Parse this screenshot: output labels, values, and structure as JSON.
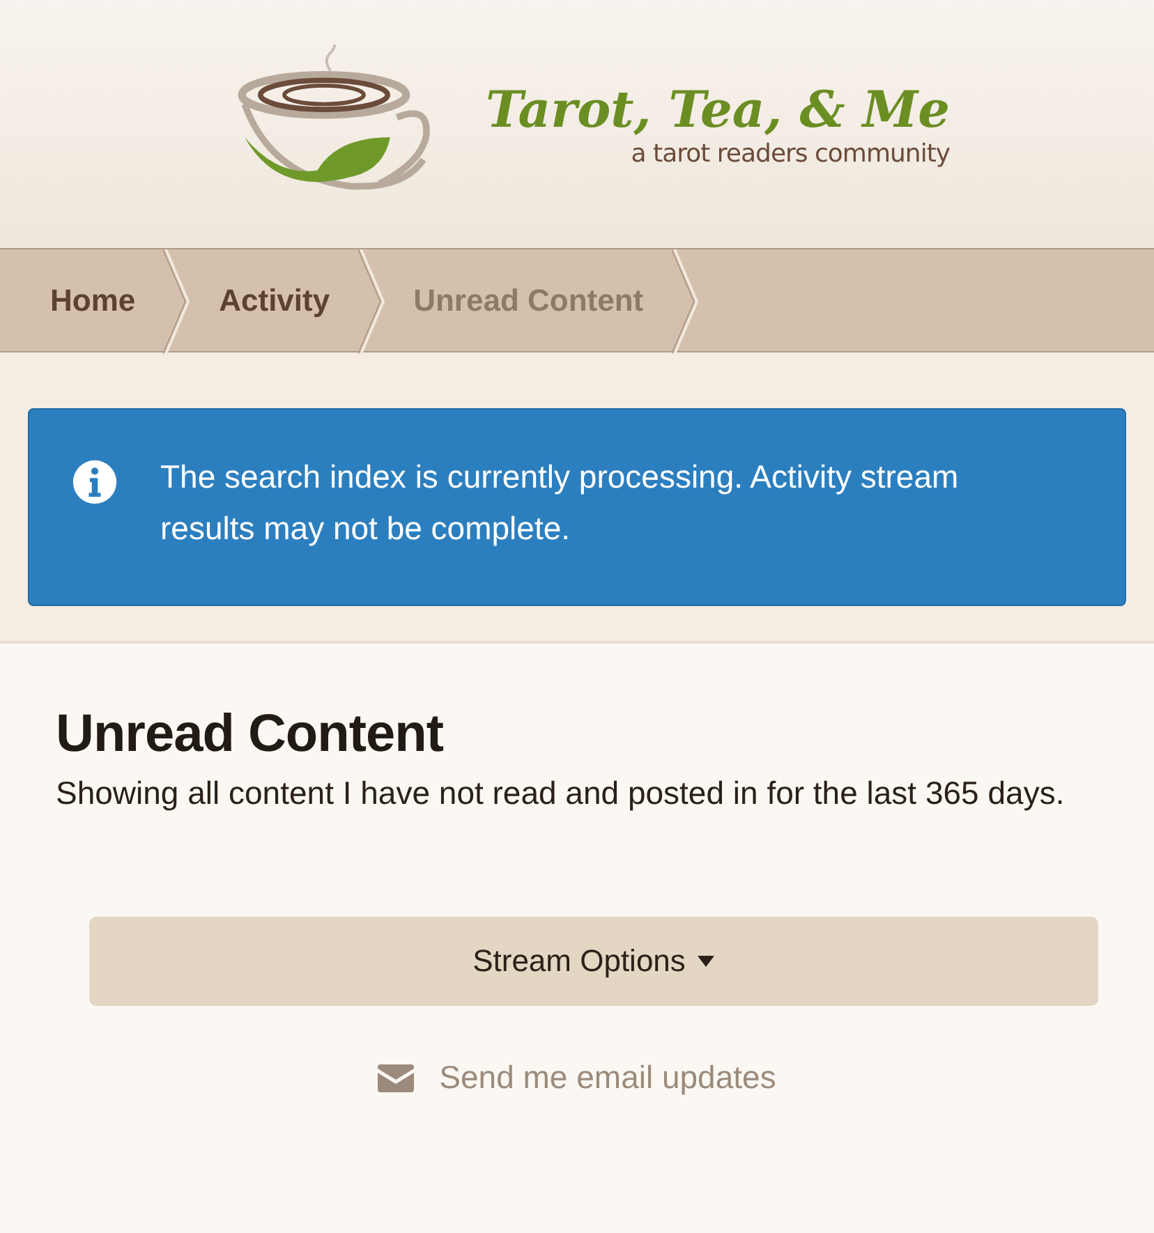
{
  "header": {
    "logo_title": "Tarot, Tea, & Me",
    "logo_tagline": "a tarot readers community"
  },
  "breadcrumb": [
    {
      "label": "Home",
      "current": false
    },
    {
      "label": "Activity",
      "current": false
    },
    {
      "label": "Unread Content",
      "current": true
    }
  ],
  "alert": {
    "message": "The search index is currently processing. Activity stream results may not be complete."
  },
  "page": {
    "title": "Unread Content",
    "description": "Showing all content I have not read and posted in for the last 365 days."
  },
  "stream_options": {
    "label": "Stream Options"
  },
  "email_link": {
    "label": "Send me email updates"
  }
}
